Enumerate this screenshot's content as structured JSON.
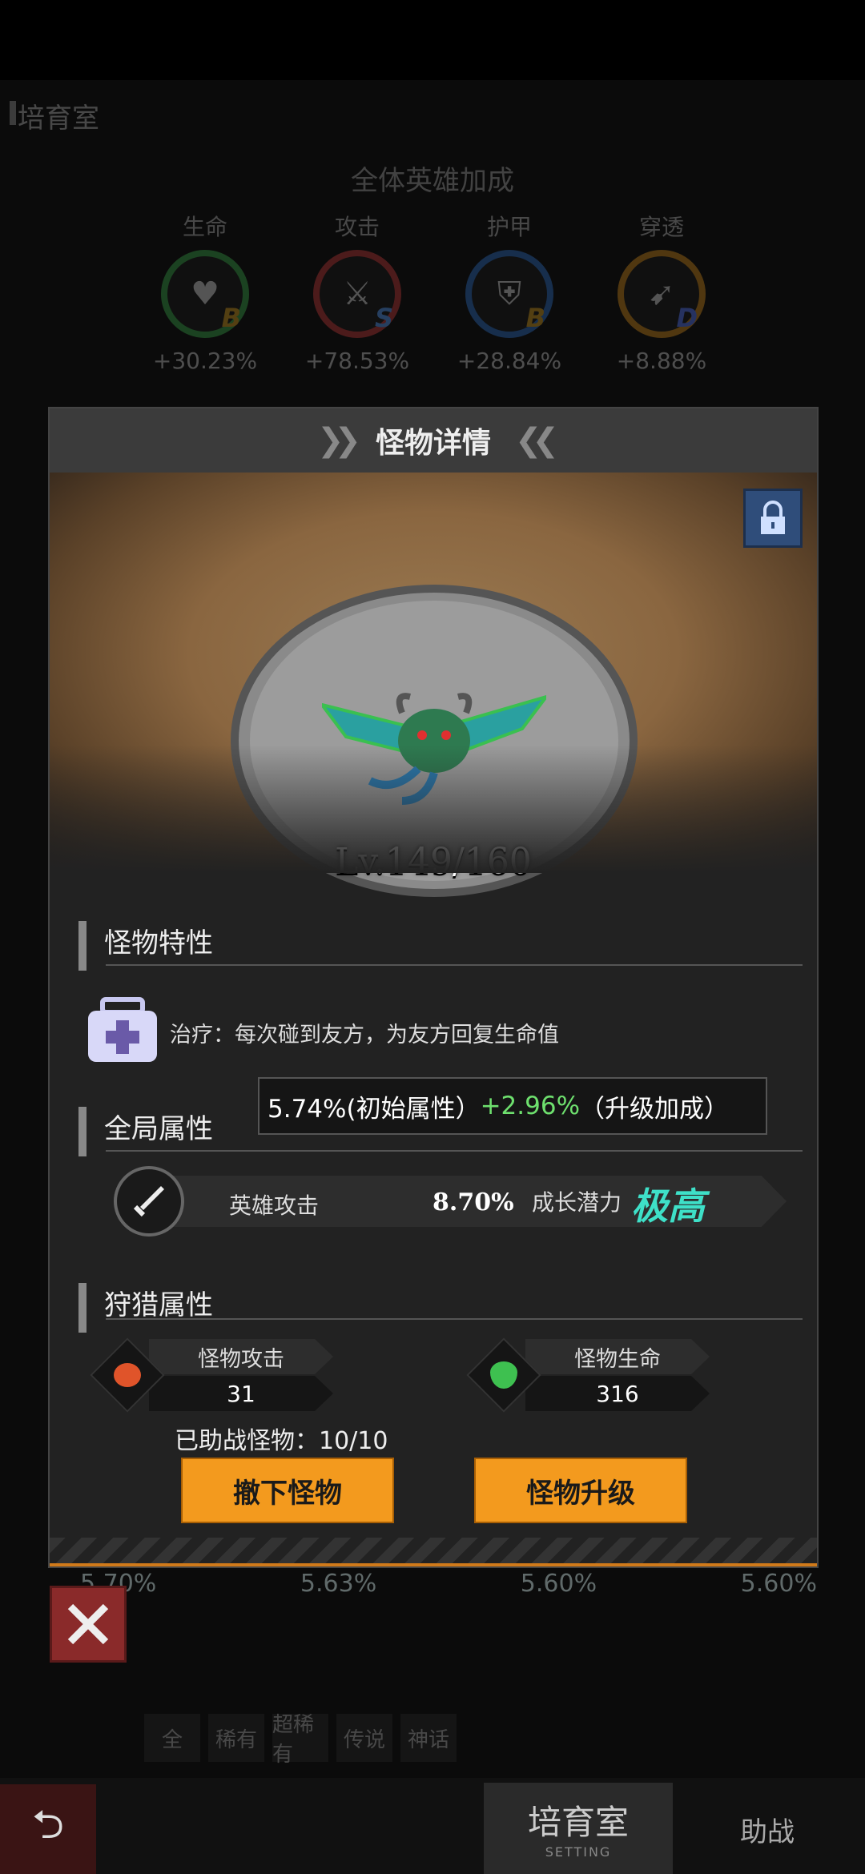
{
  "background": {
    "title": "培育室",
    "bonus_title": "全体英雄加成",
    "stats": [
      {
        "label": "生命",
        "grade": "B",
        "value": "+30.23%",
        "color": "#3aa84a"
      },
      {
        "label": "攻击",
        "grade": "S",
        "value": "+78.53%",
        "color": "#c43a3a"
      },
      {
        "label": "护甲",
        "grade": "B",
        "value": "+28.84%",
        "color": "#2e6fc4"
      },
      {
        "label": "穿透",
        "grade": "D",
        "value": "+8.88%",
        "color": "#d08a1a"
      }
    ],
    "bottom_row": [
      "5.70%",
      "5.63%",
      "5.60%",
      "5.60%"
    ],
    "filters": [
      "全",
      "稀有",
      "超稀有",
      "传说",
      "神话"
    ],
    "nav": {
      "main": "培育室",
      "main_sub": "SETTING",
      "assist": "助战"
    }
  },
  "modal": {
    "title": "怪物详情",
    "level": "Lv.149/160",
    "trait_section": "怪物特性",
    "trait_text": "治疗：每次碰到友方，为友方回复生命值",
    "global_section": "全局属性",
    "tooltip": {
      "base": "5.74%(初始属性）",
      "bonus": "+2.96%",
      "bonus_label": "（升级加成）"
    },
    "attr": {
      "name": "英雄攻击",
      "value": "8.70%",
      "growth_label": "成长潜力",
      "growth_value": "极高"
    },
    "hunt_section": "狩猎属性",
    "hunt": [
      {
        "label": "怪物攻击",
        "value": "31"
      },
      {
        "label": "怪物生命",
        "value": "316"
      }
    ],
    "assisted": "已助战怪物：10/10",
    "buttons": {
      "remove": "撤下怪物",
      "upgrade": "怪物升级"
    }
  },
  "colors": {
    "accent": "#f39a1e",
    "growth": "#3ee0c8",
    "bonus": "#6ee06e"
  }
}
